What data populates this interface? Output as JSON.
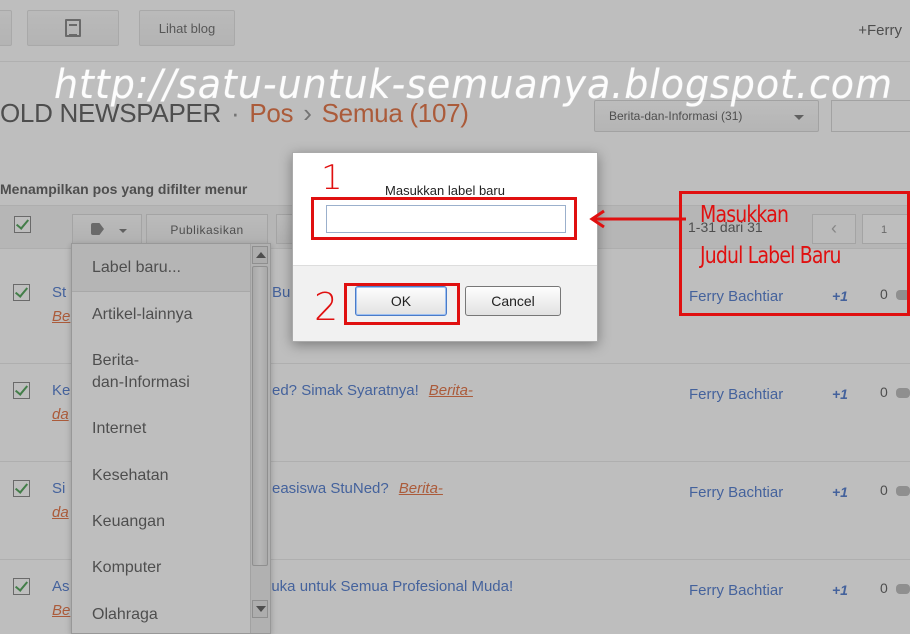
{
  "topbar": {
    "view_blog_label": "Lihat blog",
    "user_link": "+Ferry"
  },
  "header": {
    "blog_name": "OLD NEWSPAPER",
    "separator": "·",
    "section": "Pos",
    "crumb_sep": "›",
    "filter": "Semua (107)",
    "label_filter_value": "Berita-dan-Informasi (31)"
  },
  "info_line": "Menampilkan pos yang difilter menur",
  "toolbar": {
    "publish_label": "Publikasikan",
    "page_range": "1-31 dari 31",
    "page_prev": "‹",
    "page_number": "1"
  },
  "posts": [
    {
      "title": "St",
      "title_tail": "Bu",
      "label": "Be",
      "author": "Ferry Bachtiar",
      "plus": "+1",
      "comments": "0"
    },
    {
      "title": "Ke",
      "title_tail": "ed? Simak Syaratnya!",
      "label_inline": "Berita-",
      "label": "da",
      "author": "Ferry Bachtiar",
      "plus": "+1",
      "comments": "0"
    },
    {
      "title": "Si",
      "title_tail": "easiswa StuNed?",
      "label_inline": "Berita-",
      "label": "da",
      "author": "Ferry Bachtiar",
      "plus": "+1",
      "comments": "0"
    },
    {
      "title": "As",
      "title_tail": "rbuka untuk Semua Profesional Muda!",
      "label": "Be",
      "author": "Ferry Bachtiar",
      "plus": "+1",
      "comments": "0"
    }
  ],
  "label_menu": {
    "items": [
      "Label baru...",
      "Artikel-lainnya",
      "Berita-",
      "dan-Informasi",
      "Internet",
      "Kesehatan",
      "Keuangan",
      "Komputer",
      "Olahraga"
    ]
  },
  "dialog": {
    "label": "Masukkan label baru",
    "input_value": "",
    "ok_label": "OK",
    "cancel_label": "Cancel"
  },
  "annotations": {
    "step1": "1",
    "step2": "2",
    "note_line1": "Masukkan",
    "note_line2": "Judul Label Baru",
    "color": "#e01010"
  },
  "watermark": "http://satu-untuk-semuanya.blogspot.com"
}
